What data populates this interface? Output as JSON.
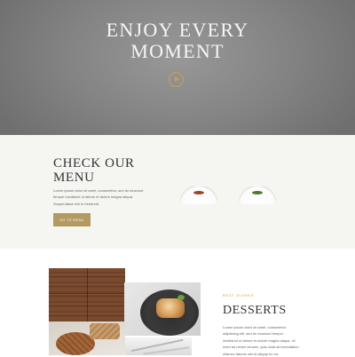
{
  "hero": {
    "title_line1": "ENJOY EVERY",
    "title_line2": "MOMENT",
    "play_icon": "play-icon"
  },
  "menu": {
    "title_line1": "CHECK OUR",
    "title_line2": "MENU",
    "text": "Lorem ipsum dolor sit amet, consectetur, sed do eiusmod tempor incididunt ut labore et dolore magna aliqua. Suspendisse nisl in hendrerit.",
    "button_label": "GO TO MENU"
  },
  "desserts": {
    "eyebrow": "BEST DISHES",
    "title": "DESSERTS",
    "text": "Lorem ipsum dolor sit amet, consectetur adipiscing elit, sed do eiusmod tempor incididunt ut labore et dolore magna aliqua. Ut enim ad minim veniam, quis nostrud exercitation ullamco laboris nisi ut aliquip ex ea."
  },
  "colors": {
    "accent": "#c8a24f",
    "button": "#b39a60",
    "section_bg": "#f5f5f2"
  }
}
